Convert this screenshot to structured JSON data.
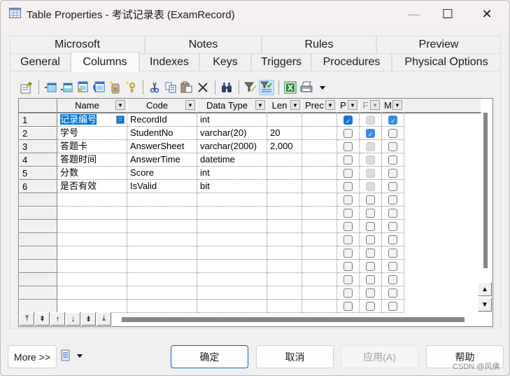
{
  "window": {
    "title": "Table Properties - 考试记录表 (ExamRecord)",
    "minimize_label": "—",
    "maximize_label": "☐",
    "close_label": "✕"
  },
  "tabs": {
    "row1": [
      {
        "label": "Microsoft"
      },
      {
        "label": "Notes"
      },
      {
        "label": "Rules"
      },
      {
        "label": "Preview"
      }
    ],
    "row2": [
      {
        "label": "General"
      },
      {
        "label": "Columns",
        "active": true
      },
      {
        "label": "Indexes"
      },
      {
        "label": "Keys"
      },
      {
        "label": "Triggers"
      },
      {
        "label": "Procedures"
      },
      {
        "label": "Physical Options"
      }
    ]
  },
  "toolbar": {
    "icons": [
      "properties-icon",
      "insert-row-icon",
      "add-row-icon",
      "add-columns-icon",
      "reuse-columns-icon",
      "new-sequence-icon",
      "new-key-icon",
      "cut-icon",
      "copy-icon",
      "paste-icon",
      "delete-icon",
      "find-icon",
      "customize-filter-icon",
      "enable-filter-icon",
      "export-excel-icon",
      "print-icon",
      "more-dropdown-icon"
    ]
  },
  "grid": {
    "columns": [
      {
        "label": "Name"
      },
      {
        "label": "Code"
      },
      {
        "label": "Data Type"
      },
      {
        "label": "Len"
      },
      {
        "label": "Prec"
      },
      {
        "label": "P"
      },
      {
        "label": "F"
      },
      {
        "label": "M"
      }
    ],
    "rows": [
      {
        "num": "1",
        "name": "记录编号",
        "code": "RecordId",
        "type": "int",
        "len": "",
        "prec": "",
        "p": true,
        "f": false,
        "m": true
      },
      {
        "num": "2",
        "name": "学号",
        "code": "StudentNo",
        "type": "varchar(20)",
        "len": "20",
        "prec": "",
        "p": false,
        "f": true,
        "m": false
      },
      {
        "num": "3",
        "name": "答题卡",
        "code": "AnswerSheet",
        "type": "varchar(2000)",
        "len": "2,000",
        "prec": "",
        "p": false,
        "f": false,
        "m": false
      },
      {
        "num": "4",
        "name": "答题时间",
        "code": "AnswerTime",
        "type": "datetime",
        "len": "",
        "prec": "",
        "p": false,
        "f": false,
        "m": false
      },
      {
        "num": "5",
        "name": "分数",
        "code": "Score",
        "type": "int",
        "len": "",
        "prec": "",
        "p": false,
        "f": false,
        "m": false
      },
      {
        "num": "6",
        "name": "是否有效",
        "code": "IsValid",
        "type": "bit",
        "len": "",
        "prec": "",
        "p": false,
        "f": false,
        "m": false
      }
    ],
    "empty_rows": 9,
    "edit_button_label": "="
  },
  "nav": {
    "buttons": [
      "⤒",
      "⇞",
      "↑",
      "↓",
      "⇟",
      "⤓"
    ]
  },
  "footer": {
    "more_label": "More >>",
    "ok_label": "确定",
    "cancel_label": "取消",
    "apply_label": "应用(A)",
    "help_label": "帮助",
    "watermark": "CSDN @风佛"
  }
}
